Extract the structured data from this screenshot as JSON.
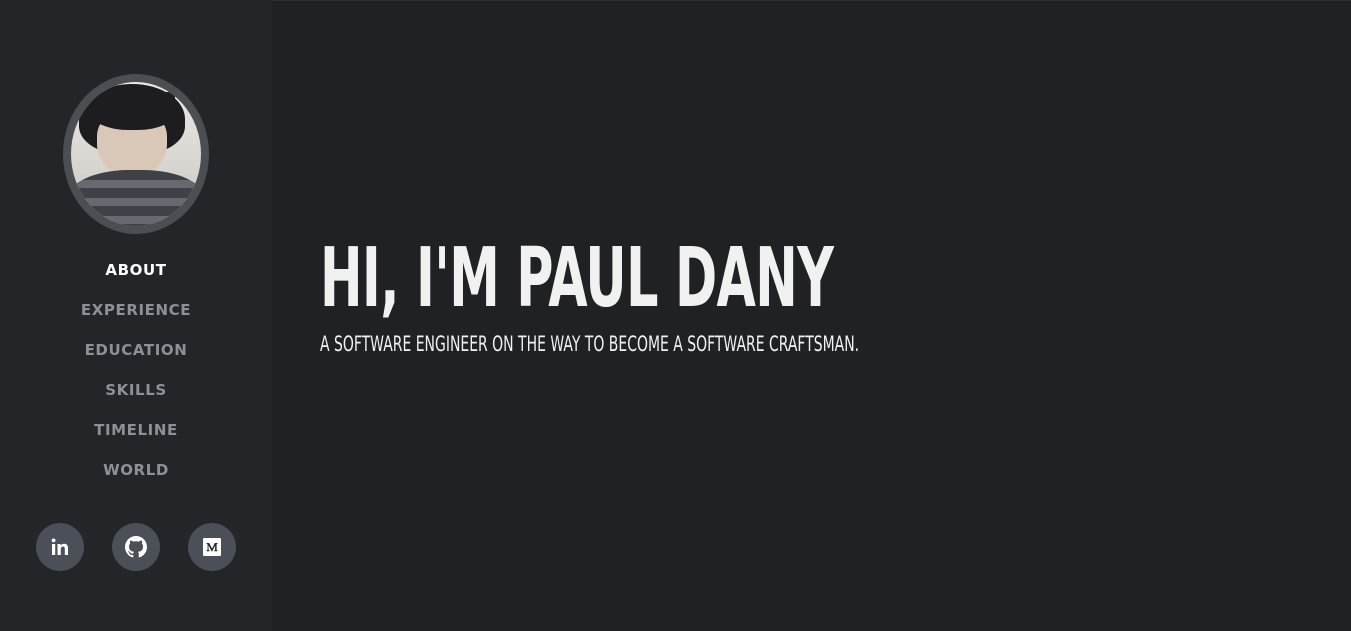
{
  "sidebar": {
    "avatar_alt": "Profile photo",
    "nav": [
      {
        "label": "ABOUT",
        "active": true
      },
      {
        "label": "EXPERIENCE",
        "active": false
      },
      {
        "label": "EDUCATION",
        "active": false
      },
      {
        "label": "SKILLS",
        "active": false
      },
      {
        "label": "TIMELINE",
        "active": false
      },
      {
        "label": "WORLD",
        "active": false
      }
    ],
    "socials": [
      {
        "icon": "linkedin-icon"
      },
      {
        "icon": "github-icon"
      },
      {
        "icon": "medium-icon"
      }
    ]
  },
  "hero": {
    "title": "HI, I'M PAUL DANY",
    "subtitle": "A SOFTWARE ENGINEER ON THE WAY TO BECOME A SOFTWARE CRAFTSMAN."
  },
  "colors": {
    "sidebar_bg": "#232529",
    "main_bg": "#1f2124",
    "nav_active": "#ffffff",
    "nav_inactive": "#8d9096",
    "social_bg": "#4b4f57"
  }
}
